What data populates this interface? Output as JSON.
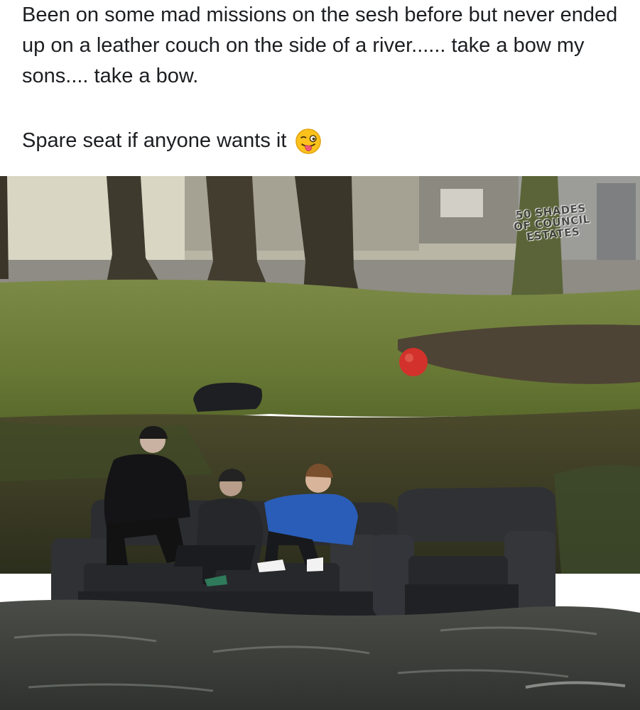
{
  "post": {
    "text_line1": "Been on some mad missions on the sesh before but never ended up on a leather couch on the side of a river...... take a bow my sons.... take a bow.",
    "text_line2": "Spare seat if anyone wants it",
    "emoji_icon": "winking-face-with-tongue-icon"
  },
  "photo": {
    "watermark": {
      "line1": "50 SHADES",
      "line2": "OF COUNCIL",
      "line3": "ESTATES"
    }
  },
  "colors": {
    "text": "#1c1e21",
    "grass": "#6e7d3a",
    "water": "#3a3d38",
    "couch": "#2a2c2e"
  }
}
